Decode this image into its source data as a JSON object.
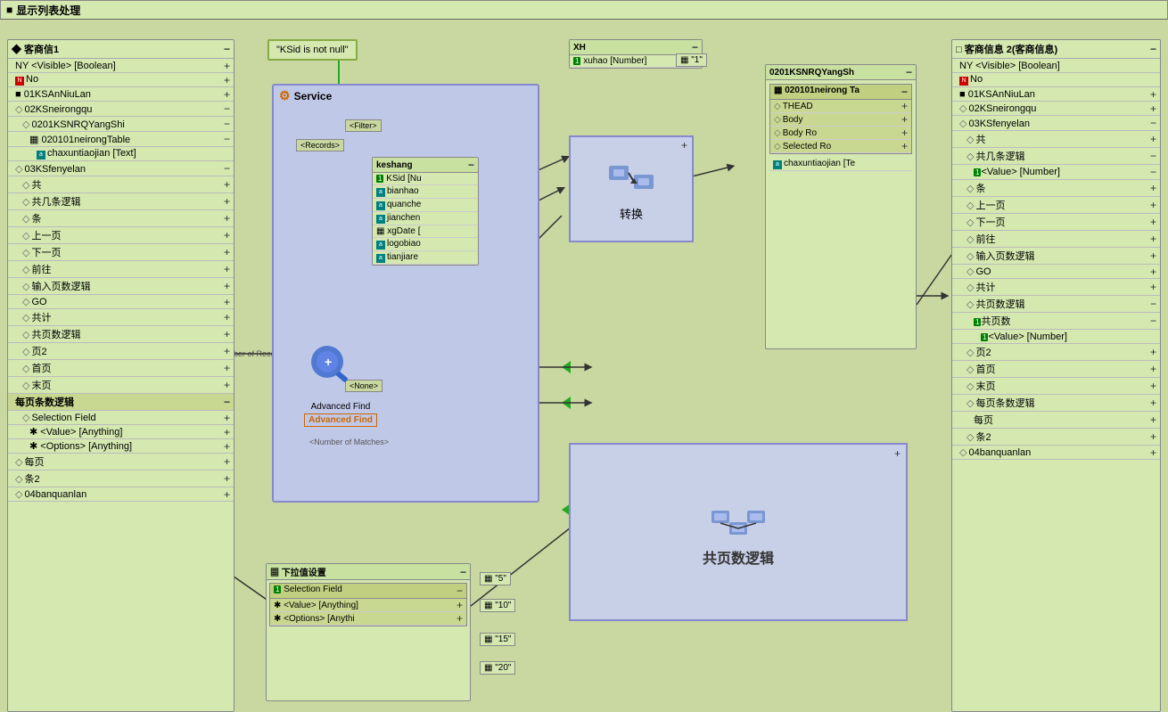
{
  "title": "显示列表处理",
  "titleIcon": "■",
  "leftPanel": {
    "title": "客商信1",
    "items": [
      {
        "label": "NY <Visible> [Boolean]",
        "type": "field",
        "indent": 0
      },
      {
        "label": "No",
        "type": "red",
        "indent": 0
      },
      {
        "label": "01KSAnNiuLan",
        "type": "dark",
        "indent": 0
      },
      {
        "label": "02KSneirongqu",
        "type": "diamond",
        "indent": 0
      },
      {
        "label": "0201KSNRQYangShi",
        "type": "indent",
        "indent": 1
      },
      {
        "label": "020101neirongTable",
        "type": "table",
        "indent": 2
      },
      {
        "label": "chaxuntiaojian [Text]",
        "type": "field",
        "indent": 3
      },
      {
        "label": "03KSfenyelan",
        "type": "diamond",
        "indent": 0
      },
      {
        "label": "共",
        "type": "diamond",
        "indent": 1
      },
      {
        "label": "共几条逻辑",
        "type": "diamond",
        "indent": 1
      },
      {
        "label": "条",
        "type": "diamond",
        "indent": 1
      },
      {
        "label": "上一页",
        "type": "diamond",
        "indent": 1
      },
      {
        "label": "下一页",
        "type": "diamond",
        "indent": 1
      },
      {
        "label": "前往",
        "type": "diamond",
        "indent": 1
      },
      {
        "label": "输入页数逻辑",
        "type": "diamond",
        "indent": 1
      },
      {
        "label": "GO",
        "type": "diamond",
        "indent": 1
      },
      {
        "label": "共计",
        "type": "diamond",
        "indent": 1
      },
      {
        "label": "共页数逻辑",
        "type": "diamond",
        "indent": 1
      },
      {
        "label": "页2",
        "type": "diamond",
        "indent": 1
      },
      {
        "label": "首页",
        "type": "diamond",
        "indent": 1
      },
      {
        "label": "末页",
        "type": "diamond",
        "indent": 1
      },
      {
        "label": "每页条数逻辑",
        "type": "section",
        "indent": 0
      },
      {
        "label": "Selection Field",
        "type": "diamond",
        "indent": 1
      },
      {
        "label": "<Value> [Anything]",
        "type": "asterisk",
        "indent": 2
      },
      {
        "label": "<Options> [Anything]",
        "type": "asterisk",
        "indent": 2
      },
      {
        "label": "每页",
        "type": "diamond",
        "indent": 0
      },
      {
        "label": "条2",
        "type": "diamond",
        "indent": 0
      },
      {
        "label": "04banquanlan",
        "type": "diamond",
        "indent": 0
      }
    ]
  },
  "rightPanel": {
    "title": "客商信息 2(客商信息)",
    "items": [
      {
        "label": "NY <Visible> [Boolean]",
        "type": "field",
        "indent": 0
      },
      {
        "label": "No",
        "type": "red",
        "indent": 0
      },
      {
        "label": "01KSAnNiuLan",
        "type": "dark",
        "indent": 0
      },
      {
        "label": "02KSneirongqu",
        "type": "diamond",
        "indent": 0
      },
      {
        "label": "03KSfenyelan",
        "type": "diamond",
        "indent": 0
      },
      {
        "label": "共",
        "type": "diamond",
        "indent": 1
      },
      {
        "label": "共几条逻辑",
        "type": "diamond",
        "indent": 1
      },
      {
        "label": "<Value> [Number]",
        "type": "number",
        "indent": 2
      },
      {
        "label": "条",
        "type": "diamond",
        "indent": 1
      },
      {
        "label": "上一页",
        "type": "diamond",
        "indent": 1
      },
      {
        "label": "下一页",
        "type": "diamond",
        "indent": 1
      },
      {
        "label": "前往",
        "type": "diamond",
        "indent": 1
      },
      {
        "label": "输入页数逻辑",
        "type": "diamond",
        "indent": 1
      },
      {
        "label": "GO",
        "type": "diamond",
        "indent": 1
      },
      {
        "label": "共计",
        "type": "diamond",
        "indent": 1
      },
      {
        "label": "共页数逻辑",
        "type": "diamond",
        "indent": 1
      },
      {
        "label": "共页数",
        "type": "number-plain",
        "indent": 2
      },
      {
        "label": "<Value> [Number]",
        "type": "number",
        "indent": 3
      },
      {
        "label": "页2",
        "type": "diamond",
        "indent": 1
      },
      {
        "label": "首页",
        "type": "diamond",
        "indent": 1
      },
      {
        "label": "末页",
        "type": "diamond",
        "indent": 1
      },
      {
        "label": "每页条数逻辑",
        "type": "diamond",
        "indent": 1
      },
      {
        "label": "每页",
        "type": "diamond",
        "indent": 2
      },
      {
        "label": "条2",
        "type": "diamond",
        "indent": 1
      },
      {
        "label": "04banquanlan",
        "type": "diamond",
        "indent": 0
      }
    ]
  },
  "conditionNode": {
    "label": "\"KSid is not null\""
  },
  "serviceLabel": "Service",
  "keshangNode": {
    "title": "keshang",
    "fields": [
      "KSid [Nu",
      "bianhao",
      "quanche",
      "jiancher",
      "xgDate [",
      "logobiao",
      "tianjiare"
    ]
  },
  "xhPanel": {
    "title": "XH",
    "field": "xuhao [Number]",
    "value": "\"1\""
  },
  "transform": {
    "label": "转换"
  },
  "panel0201": {
    "title": "0201KSNRQYangSh",
    "subpanel": "020101neirong Ta",
    "items": [
      "THEAD",
      "Body",
      "Body Ro",
      "Selected Ro"
    ],
    "extra": "chaxuntiaojian [Te"
  },
  "advancedFind": {
    "label": "Advanced Find",
    "badge": "Advanced Find",
    "filter": "<Filter>",
    "records": "<Records>",
    "none": "<None>",
    "matches": "Number of Matches>"
  },
  "sharedLogic": {
    "label": "共页数逻辑"
  },
  "dropdownPanel": {
    "title": "下拉值设置",
    "selectionField": "Selection Field",
    "value": "<Value> [Anything]",
    "options": "<Options> [Anything]",
    "values": [
      "\"5\"",
      "\"10\"",
      "\"15\"",
      "\"20\""
    ]
  },
  "colors": {
    "panelBg": "#d4e8b0",
    "blueBg": "#c8d0e8",
    "accent": "#88aa44",
    "border": "#888888"
  }
}
